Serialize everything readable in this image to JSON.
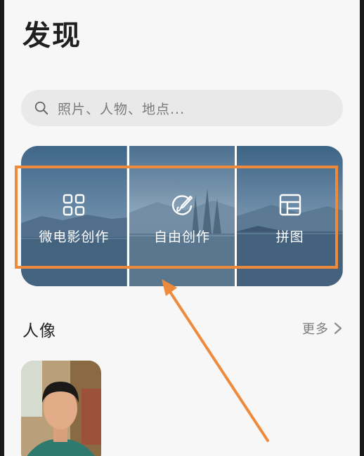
{
  "header": {
    "title": "发现"
  },
  "search": {
    "placeholder": "照片、人物、地点..."
  },
  "tiles": [
    {
      "label": "微电影创作",
      "icon": "grid-icon"
    },
    {
      "label": "自由创作",
      "icon": "palette-brush-icon"
    },
    {
      "label": "拼图",
      "icon": "collage-icon"
    }
  ],
  "people_section": {
    "title": "人像",
    "more_label": "更多"
  },
  "colors": {
    "highlight": "#ee8a3c",
    "tile_sky": "#5e7e9e",
    "background": "#f7f7f7"
  }
}
